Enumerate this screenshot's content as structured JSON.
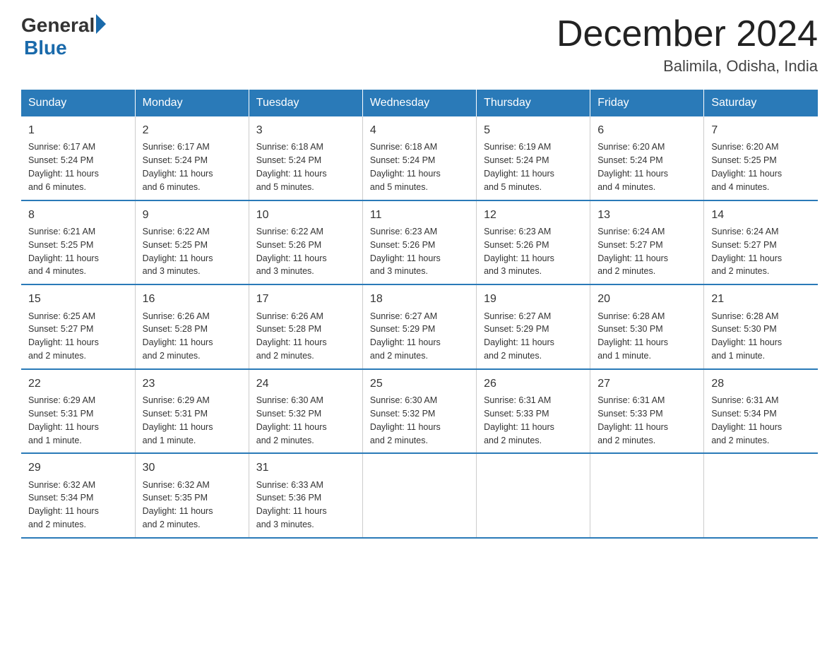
{
  "logo": {
    "general": "General",
    "blue": "Blue",
    "arrow": "▶"
  },
  "title": "December 2024",
  "subtitle": "Balimila, Odisha, India",
  "days": [
    "Sunday",
    "Monday",
    "Tuesday",
    "Wednesday",
    "Thursday",
    "Friday",
    "Saturday"
  ],
  "weeks": [
    [
      {
        "num": "1",
        "info": "Sunrise: 6:17 AM\nSunset: 5:24 PM\nDaylight: 11 hours\nand 6 minutes."
      },
      {
        "num": "2",
        "info": "Sunrise: 6:17 AM\nSunset: 5:24 PM\nDaylight: 11 hours\nand 6 minutes."
      },
      {
        "num": "3",
        "info": "Sunrise: 6:18 AM\nSunset: 5:24 PM\nDaylight: 11 hours\nand 5 minutes."
      },
      {
        "num": "4",
        "info": "Sunrise: 6:18 AM\nSunset: 5:24 PM\nDaylight: 11 hours\nand 5 minutes."
      },
      {
        "num": "5",
        "info": "Sunrise: 6:19 AM\nSunset: 5:24 PM\nDaylight: 11 hours\nand 5 minutes."
      },
      {
        "num": "6",
        "info": "Sunrise: 6:20 AM\nSunset: 5:24 PM\nDaylight: 11 hours\nand 4 minutes."
      },
      {
        "num": "7",
        "info": "Sunrise: 6:20 AM\nSunset: 5:25 PM\nDaylight: 11 hours\nand 4 minutes."
      }
    ],
    [
      {
        "num": "8",
        "info": "Sunrise: 6:21 AM\nSunset: 5:25 PM\nDaylight: 11 hours\nand 4 minutes."
      },
      {
        "num": "9",
        "info": "Sunrise: 6:22 AM\nSunset: 5:25 PM\nDaylight: 11 hours\nand 3 minutes."
      },
      {
        "num": "10",
        "info": "Sunrise: 6:22 AM\nSunset: 5:26 PM\nDaylight: 11 hours\nand 3 minutes."
      },
      {
        "num": "11",
        "info": "Sunrise: 6:23 AM\nSunset: 5:26 PM\nDaylight: 11 hours\nand 3 minutes."
      },
      {
        "num": "12",
        "info": "Sunrise: 6:23 AM\nSunset: 5:26 PM\nDaylight: 11 hours\nand 3 minutes."
      },
      {
        "num": "13",
        "info": "Sunrise: 6:24 AM\nSunset: 5:27 PM\nDaylight: 11 hours\nand 2 minutes."
      },
      {
        "num": "14",
        "info": "Sunrise: 6:24 AM\nSunset: 5:27 PM\nDaylight: 11 hours\nand 2 minutes."
      }
    ],
    [
      {
        "num": "15",
        "info": "Sunrise: 6:25 AM\nSunset: 5:27 PM\nDaylight: 11 hours\nand 2 minutes."
      },
      {
        "num": "16",
        "info": "Sunrise: 6:26 AM\nSunset: 5:28 PM\nDaylight: 11 hours\nand 2 minutes."
      },
      {
        "num": "17",
        "info": "Sunrise: 6:26 AM\nSunset: 5:28 PM\nDaylight: 11 hours\nand 2 minutes."
      },
      {
        "num": "18",
        "info": "Sunrise: 6:27 AM\nSunset: 5:29 PM\nDaylight: 11 hours\nand 2 minutes."
      },
      {
        "num": "19",
        "info": "Sunrise: 6:27 AM\nSunset: 5:29 PM\nDaylight: 11 hours\nand 2 minutes."
      },
      {
        "num": "20",
        "info": "Sunrise: 6:28 AM\nSunset: 5:30 PM\nDaylight: 11 hours\nand 1 minute."
      },
      {
        "num": "21",
        "info": "Sunrise: 6:28 AM\nSunset: 5:30 PM\nDaylight: 11 hours\nand 1 minute."
      }
    ],
    [
      {
        "num": "22",
        "info": "Sunrise: 6:29 AM\nSunset: 5:31 PM\nDaylight: 11 hours\nand 1 minute."
      },
      {
        "num": "23",
        "info": "Sunrise: 6:29 AM\nSunset: 5:31 PM\nDaylight: 11 hours\nand 1 minute."
      },
      {
        "num": "24",
        "info": "Sunrise: 6:30 AM\nSunset: 5:32 PM\nDaylight: 11 hours\nand 2 minutes."
      },
      {
        "num": "25",
        "info": "Sunrise: 6:30 AM\nSunset: 5:32 PM\nDaylight: 11 hours\nand 2 minutes."
      },
      {
        "num": "26",
        "info": "Sunrise: 6:31 AM\nSunset: 5:33 PM\nDaylight: 11 hours\nand 2 minutes."
      },
      {
        "num": "27",
        "info": "Sunrise: 6:31 AM\nSunset: 5:33 PM\nDaylight: 11 hours\nand 2 minutes."
      },
      {
        "num": "28",
        "info": "Sunrise: 6:31 AM\nSunset: 5:34 PM\nDaylight: 11 hours\nand 2 minutes."
      }
    ],
    [
      {
        "num": "29",
        "info": "Sunrise: 6:32 AM\nSunset: 5:34 PM\nDaylight: 11 hours\nand 2 minutes."
      },
      {
        "num": "30",
        "info": "Sunrise: 6:32 AM\nSunset: 5:35 PM\nDaylight: 11 hours\nand 2 minutes."
      },
      {
        "num": "31",
        "info": "Sunrise: 6:33 AM\nSunset: 5:36 PM\nDaylight: 11 hours\nand 3 minutes."
      },
      {
        "num": "",
        "info": ""
      },
      {
        "num": "",
        "info": ""
      },
      {
        "num": "",
        "info": ""
      },
      {
        "num": "",
        "info": ""
      }
    ]
  ]
}
